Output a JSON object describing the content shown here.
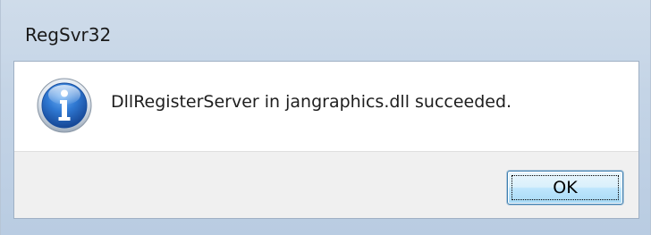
{
  "window": {
    "title": "RegSvr32"
  },
  "dialog": {
    "icon": "information-icon",
    "message": "DllRegisterServer in jangraphics.dll succeeded.",
    "ok_label": "OK"
  },
  "colors": {
    "frame": "#c4d4e6",
    "client_bg": "#ffffff",
    "footer_bg": "#f0f0f0",
    "icon_blue": "#1f5fb8",
    "button_border": "#3c7fb1"
  }
}
